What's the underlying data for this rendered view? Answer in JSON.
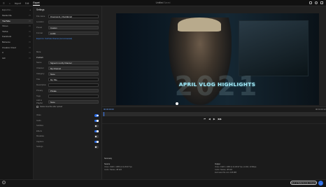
{
  "topbar": {
    "nav": [
      "Home",
      "Import",
      "Edit",
      "Export"
    ],
    "active_nav": "Export",
    "title": "Untitled",
    "title_suffix": "Saved"
  },
  "sidebar": {
    "header": "Export to...",
    "header_count": "",
    "items": [
      {
        "label": "Media File",
        "count": "",
        "selected": false
      },
      {
        "label": "YouTube",
        "count": "",
        "selected": true
      },
      {
        "label": "Vimeo",
        "count": "",
        "selected": false
      },
      {
        "label": "TikTok",
        "count": "",
        "selected": false
      },
      {
        "label": "Facebook",
        "count": "",
        "selected": false
      },
      {
        "label": "Behance",
        "count": "",
        "selected": false
      },
      {
        "label": "Creative Cloud",
        "count": "",
        "selected": false
      },
      {
        "label": "X",
        "count": "",
        "selected": false
      },
      {
        "label": "GIF",
        "count": "",
        "selected": false
      }
    ]
  },
  "settings": {
    "title": "Settings",
    "rows": [
      {
        "label": "File name",
        "value": "Dreamwork_CheckEmail",
        "dark": true
      },
      {
        "label": "Location",
        "value": "",
        "dark": false
      },
      {
        "label": "Preset",
        "value": "Custom",
        "dark": false
      },
      {
        "label": "Format",
        "value": "H.264",
        "dark": false
      }
    ],
    "account_link": "Export to: YouTube Channel (not connected)",
    "more_label": "More",
    "publish_section": "Publish",
    "publish_sub": "Signed in to My Channel",
    "publish_action": "Sign Out",
    "pub_rows": [
      {
        "label": "Name",
        "value": "Signed in to My Channel",
        "dark": false
      },
      {
        "label": "Channel",
        "value": "My Channel",
        "dark": false
      },
      {
        "label": "Category",
        "value": "None",
        "dark": false
      },
      {
        "label": "Title",
        "value": "My Title",
        "dark": true
      },
      {
        "label": "Description",
        "value": "",
        "dark": true
      },
      {
        "label": "Privacy",
        "value": "Private",
        "dark": false
      },
      {
        "label": "Tags",
        "value": "",
        "dark": true
      },
      {
        "label": "Add to Playlist",
        "value": "None",
        "dark": false
      }
    ],
    "checkbox_label": "Delete local file after upload",
    "toggles": [
      {
        "label": "Video",
        "on": true
      },
      {
        "label": "Audio",
        "on": true
      },
      {
        "label": "Subtitles",
        "on": false
      },
      {
        "label": "Effects",
        "on": true
      },
      {
        "label": "Metadata",
        "on": false
      },
      {
        "label": "Captions",
        "on": true
      },
      {
        "label": "Settings",
        "on": false
      }
    ]
  },
  "preview": {
    "year": "2021",
    "headline": "APRIL VLOG HIGHLIGHTS",
    "time_left": "00:00:00:00",
    "time_right": "00:01:02:12",
    "transport": [
      "⏮",
      "◀",
      "▶",
      "▶▶"
    ]
  },
  "info": {
    "summary_title": "Summary",
    "left_title": "Source",
    "left_lines": [
      {
        "k": "Video:",
        "v": "1920 x 1080 (1.0) 29.97 fps"
      },
      {
        "k": "Audio:",
        "v": "Stereo, 48 kHz"
      }
    ],
    "right_title": "Output",
    "right_lines": [
      {
        "k": "Video:",
        "v": "1920 x 1080 (1.0) 29.97 fps, H.264, 10 Mbps"
      },
      {
        "k": "Audio:",
        "v": "Stereo, 48 kHz"
      },
      {
        "k": "Estimated file size:",
        "v": "106 MB"
      }
    ]
  },
  "bottom": {
    "help": "?",
    "export_label": "Send to Media Encoder & Export",
    "export_icon": "→"
  }
}
